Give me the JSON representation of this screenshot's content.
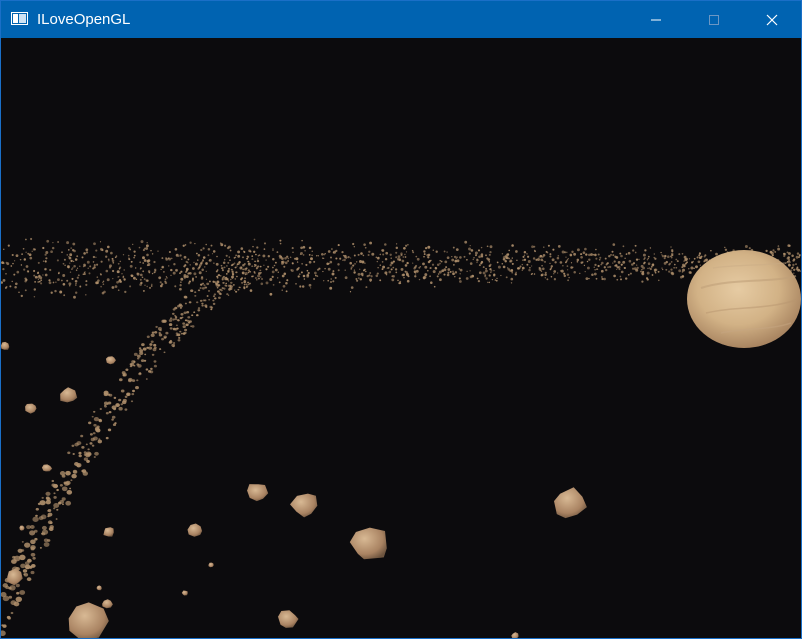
{
  "window": {
    "title": "ILoveOpenGL",
    "app_icon": "window-app-icon",
    "controls": {
      "minimize_icon": "minimize-icon",
      "maximize_icon": "maximize-icon",
      "close_icon": "close-icon"
    },
    "colors": {
      "titlebar": "#0063b1",
      "title_text": "#ffffff",
      "background": "#0c0b0d",
      "asteroid": "#b0906c",
      "planet": "#d9b98f"
    }
  },
  "scene": {
    "description_icon": "opengl-viewport",
    "objects": [
      "planet",
      "asteroid-belt"
    ]
  }
}
